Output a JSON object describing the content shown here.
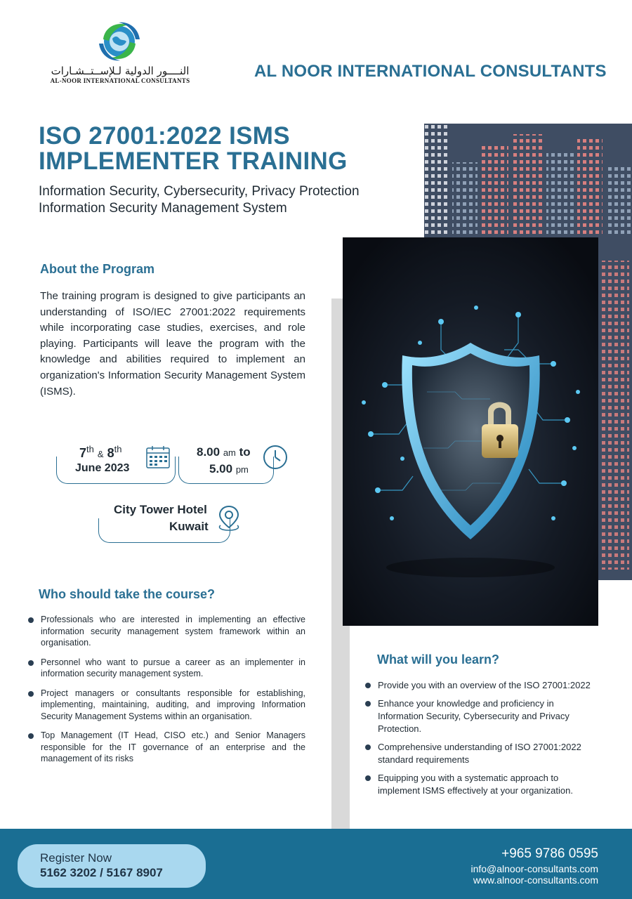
{
  "header": {
    "logo_arabic": "النــــور الدولية لـلإســتــشـارات",
    "logo_english": "AL-NOOR INTERNATIONAL CONSULTANTS",
    "company_name": "AL NOOR INTERNATIONAL CONSULTANTS"
  },
  "title": {
    "line1": "ISO 27001:2022 ISMS",
    "line2": "IMPLEMENTER TRAINING",
    "subtitle1": "Information Security, Cybersecurity, Privacy Protection",
    "subtitle2": "Information Security Management System"
  },
  "about": {
    "heading": "About the Program",
    "text": "The training program is designed to give participants an understanding of ISO/IEC 27001:2022 requirements while incorporating case studies, exercises, and role playing. Participants will leave the program with the knowledge and abilities required to implement an organization's Information Security Management System (ISMS)."
  },
  "schedule": {
    "day1": "7",
    "day1_sup": "th",
    "amp": "&",
    "day2": "8",
    "day2_sup": "th",
    "month_year": "June 2023",
    "time_start": "8.00",
    "time_start_unit": "am",
    "to": "to",
    "time_end": "5.00",
    "time_end_unit": "pm",
    "venue": "City Tower Hotel",
    "city": "Kuwait"
  },
  "who": {
    "heading": "Who should take the course?",
    "items": [
      "Professionals who are interested in implementing an effective information security management system framework within an organisation.",
      "Personnel who want to pursue a career as an implementer in information security management system.",
      "Project managers or consultants responsible for establishing, implementing, maintaining, auditing, and improving Information Security Management Systems within an organisation.",
      "Top Management (IT Head, CISO etc.) and Senior Managers responsible for the IT governance of an enterprise and the management of its risks"
    ]
  },
  "learn": {
    "heading": "What will you learn?",
    "items": [
      "Provide you with an overview of the ISO 27001:2022",
      "Enhance your knowledge and proficiency in Information Security, Cybersecurity and Privacy Protection.",
      "Comprehensive understanding of ISO 27001:2022 standard requirements",
      "Equipping you with a systematic approach to implement ISMS effectively at your organization."
    ]
  },
  "footer": {
    "register_label": "Register Now",
    "register_phones": "5162 3202 / 5167 8907",
    "phone": "+965 9786 0595",
    "email": "info@alnoor-consultants.com",
    "website": "www.alnoor-consultants.com"
  },
  "colors": {
    "brand_blue": "#2a6f93",
    "footer_blue": "#1a6e93",
    "register_pill": "#a9d8ef",
    "city_navy": "#3f4d63"
  },
  "icons": [
    "logo-globe-icon",
    "calendar-icon",
    "clock-icon",
    "location-pin-icon",
    "padlock-shield-icon"
  ]
}
